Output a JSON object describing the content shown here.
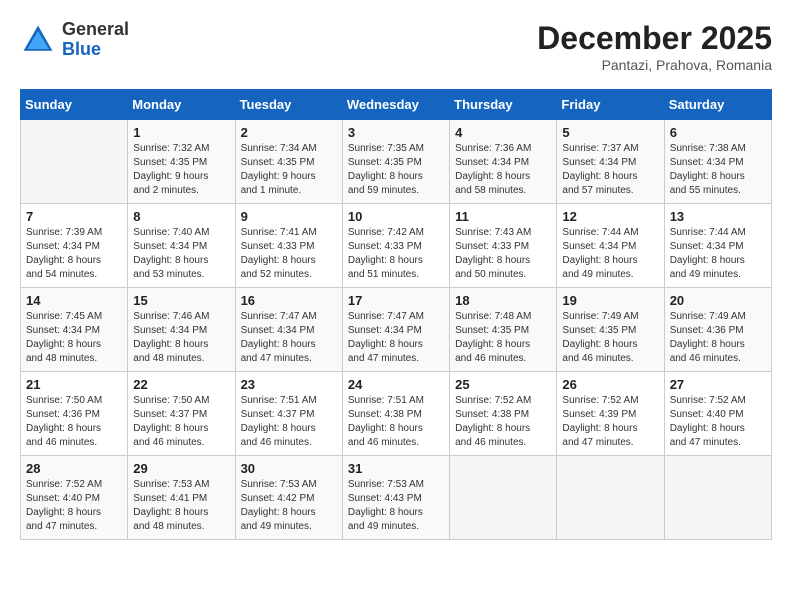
{
  "logo": {
    "general": "General",
    "blue": "Blue"
  },
  "header": {
    "month": "December 2025",
    "location": "Pantazi, Prahova, Romania"
  },
  "weekdays": [
    "Sunday",
    "Monday",
    "Tuesday",
    "Wednesday",
    "Thursday",
    "Friday",
    "Saturday"
  ],
  "weeks": [
    [
      {
        "day": "",
        "info": ""
      },
      {
        "day": "1",
        "info": "Sunrise: 7:32 AM\nSunset: 4:35 PM\nDaylight: 9 hours\nand 2 minutes."
      },
      {
        "day": "2",
        "info": "Sunrise: 7:34 AM\nSunset: 4:35 PM\nDaylight: 9 hours\nand 1 minute."
      },
      {
        "day": "3",
        "info": "Sunrise: 7:35 AM\nSunset: 4:35 PM\nDaylight: 8 hours\nand 59 minutes."
      },
      {
        "day": "4",
        "info": "Sunrise: 7:36 AM\nSunset: 4:34 PM\nDaylight: 8 hours\nand 58 minutes."
      },
      {
        "day": "5",
        "info": "Sunrise: 7:37 AM\nSunset: 4:34 PM\nDaylight: 8 hours\nand 57 minutes."
      },
      {
        "day": "6",
        "info": "Sunrise: 7:38 AM\nSunset: 4:34 PM\nDaylight: 8 hours\nand 55 minutes."
      }
    ],
    [
      {
        "day": "7",
        "info": "Sunrise: 7:39 AM\nSunset: 4:34 PM\nDaylight: 8 hours\nand 54 minutes."
      },
      {
        "day": "8",
        "info": "Sunrise: 7:40 AM\nSunset: 4:34 PM\nDaylight: 8 hours\nand 53 minutes."
      },
      {
        "day": "9",
        "info": "Sunrise: 7:41 AM\nSunset: 4:33 PM\nDaylight: 8 hours\nand 52 minutes."
      },
      {
        "day": "10",
        "info": "Sunrise: 7:42 AM\nSunset: 4:33 PM\nDaylight: 8 hours\nand 51 minutes."
      },
      {
        "day": "11",
        "info": "Sunrise: 7:43 AM\nSunset: 4:33 PM\nDaylight: 8 hours\nand 50 minutes."
      },
      {
        "day": "12",
        "info": "Sunrise: 7:44 AM\nSunset: 4:34 PM\nDaylight: 8 hours\nand 49 minutes."
      },
      {
        "day": "13",
        "info": "Sunrise: 7:44 AM\nSunset: 4:34 PM\nDaylight: 8 hours\nand 49 minutes."
      }
    ],
    [
      {
        "day": "14",
        "info": "Sunrise: 7:45 AM\nSunset: 4:34 PM\nDaylight: 8 hours\nand 48 minutes."
      },
      {
        "day": "15",
        "info": "Sunrise: 7:46 AM\nSunset: 4:34 PM\nDaylight: 8 hours\nand 48 minutes."
      },
      {
        "day": "16",
        "info": "Sunrise: 7:47 AM\nSunset: 4:34 PM\nDaylight: 8 hours\nand 47 minutes."
      },
      {
        "day": "17",
        "info": "Sunrise: 7:47 AM\nSunset: 4:34 PM\nDaylight: 8 hours\nand 47 minutes."
      },
      {
        "day": "18",
        "info": "Sunrise: 7:48 AM\nSunset: 4:35 PM\nDaylight: 8 hours\nand 46 minutes."
      },
      {
        "day": "19",
        "info": "Sunrise: 7:49 AM\nSunset: 4:35 PM\nDaylight: 8 hours\nand 46 minutes."
      },
      {
        "day": "20",
        "info": "Sunrise: 7:49 AM\nSunset: 4:36 PM\nDaylight: 8 hours\nand 46 minutes."
      }
    ],
    [
      {
        "day": "21",
        "info": "Sunrise: 7:50 AM\nSunset: 4:36 PM\nDaylight: 8 hours\nand 46 minutes."
      },
      {
        "day": "22",
        "info": "Sunrise: 7:50 AM\nSunset: 4:37 PM\nDaylight: 8 hours\nand 46 minutes."
      },
      {
        "day": "23",
        "info": "Sunrise: 7:51 AM\nSunset: 4:37 PM\nDaylight: 8 hours\nand 46 minutes."
      },
      {
        "day": "24",
        "info": "Sunrise: 7:51 AM\nSunset: 4:38 PM\nDaylight: 8 hours\nand 46 minutes."
      },
      {
        "day": "25",
        "info": "Sunrise: 7:52 AM\nSunset: 4:38 PM\nDaylight: 8 hours\nand 46 minutes."
      },
      {
        "day": "26",
        "info": "Sunrise: 7:52 AM\nSunset: 4:39 PM\nDaylight: 8 hours\nand 47 minutes."
      },
      {
        "day": "27",
        "info": "Sunrise: 7:52 AM\nSunset: 4:40 PM\nDaylight: 8 hours\nand 47 minutes."
      }
    ],
    [
      {
        "day": "28",
        "info": "Sunrise: 7:52 AM\nSunset: 4:40 PM\nDaylight: 8 hours\nand 47 minutes."
      },
      {
        "day": "29",
        "info": "Sunrise: 7:53 AM\nSunset: 4:41 PM\nDaylight: 8 hours\nand 48 minutes."
      },
      {
        "day": "30",
        "info": "Sunrise: 7:53 AM\nSunset: 4:42 PM\nDaylight: 8 hours\nand 49 minutes."
      },
      {
        "day": "31",
        "info": "Sunrise: 7:53 AM\nSunset: 4:43 PM\nDaylight: 8 hours\nand 49 minutes."
      },
      {
        "day": "",
        "info": ""
      },
      {
        "day": "",
        "info": ""
      },
      {
        "day": "",
        "info": ""
      }
    ]
  ]
}
